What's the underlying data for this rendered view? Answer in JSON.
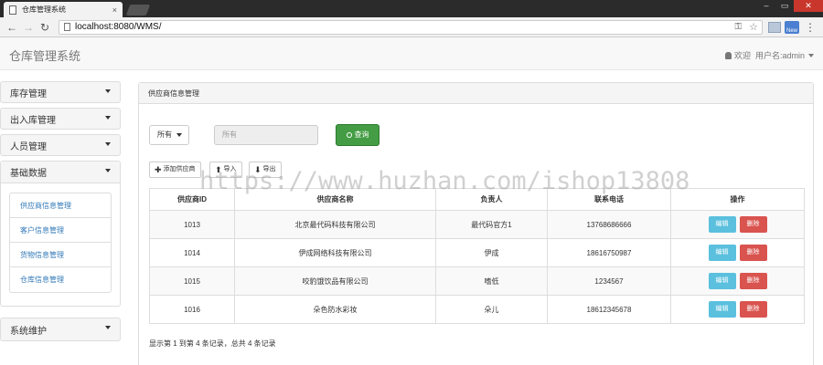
{
  "browser": {
    "tab_title": "仓库管理系统",
    "tab_close": "×",
    "url": "localhost:8080/WMS/",
    "window_controls": [
      "‒",
      "▭",
      "✕"
    ],
    "ext_label": "New"
  },
  "header": {
    "brand": "仓库管理系统",
    "welcome": "欢迎",
    "user_label": "用户名:admin"
  },
  "sidebar": {
    "items": [
      {
        "label": "库存管理"
      },
      {
        "label": "出入库管理"
      },
      {
        "label": "人员管理"
      },
      {
        "label": "基础数据"
      }
    ],
    "submenu": [
      {
        "label": "供应商信息管理"
      },
      {
        "label": "客户信息管理"
      },
      {
        "label": "货物信息管理"
      },
      {
        "label": "仓库信息管理"
      }
    ],
    "last_item": "系统维护"
  },
  "panel": {
    "title": "供应商信息管理",
    "filter_select": "所有",
    "filter_placeholder": "所有",
    "query_label": "查询",
    "toolbar": {
      "add_label": "添加供应商",
      "import_label": "导入",
      "export_label": "导出"
    },
    "table": {
      "headers": [
        "供应商ID",
        "供应商名称",
        "负责人",
        "联系电话",
        "操作"
      ],
      "rows": [
        {
          "id": "1013",
          "name": "北京最代码科技有限公司",
          "contact": "最代码官方1",
          "phone": "13768686666"
        },
        {
          "id": "1014",
          "name": "伊成网络科技有限公司",
          "contact": "伊成",
          "phone": "18616750987"
        },
        {
          "id": "1015",
          "name": "咬豹饿饮品有限公司",
          "contact": "嗜低",
          "phone": "1234567"
        },
        {
          "id": "1016",
          "name": "朵色防水彩妆",
          "contact": "朵儿",
          "phone": "18612345678"
        }
      ],
      "edit_label": "编辑",
      "delete_label": "删除"
    },
    "footer": "显示第 1 到第 4 条记录，总共 4 条记录"
  },
  "watermark": "https://www.huzhan.com/ishop13808"
}
